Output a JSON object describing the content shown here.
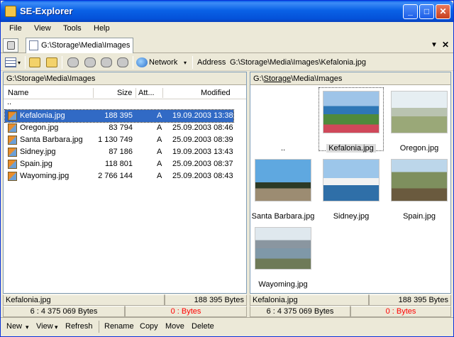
{
  "window": {
    "title": "SE-Explorer",
    "minimize": "_",
    "maximize": "□",
    "close": "✕"
  },
  "menu": [
    "File",
    "View",
    "Tools",
    "Help"
  ],
  "tab": {
    "label": "G:\\Storage\\Media\\Images",
    "dropdown": "▼",
    "close": "✕"
  },
  "toolbar": {
    "network_label": "Network",
    "address_label": "Address",
    "address_value": "G:\\Storage\\Media\\Images\\Kefalonia.jpg",
    "icons": [
      "view-mode-icon",
      "new-folder-icon",
      "up-folder-icon",
      "drive-c-icon",
      "drive-e-icon",
      "drive-f-icon",
      "drive-g-icon",
      "network-icon"
    ]
  },
  "left_pane": {
    "path": "G:\\Storage\\Media\\Images",
    "columns": [
      "Name",
      "Size",
      "Att...",
      "Modified"
    ],
    "parent": "..",
    "rows": [
      {
        "name": "Kefalonia.jpg",
        "size": "188 395",
        "attr": "A",
        "modified": "19.09.2003 13:38",
        "selected": true
      },
      {
        "name": "Oregon.jpg",
        "size": "83 794",
        "attr": "A",
        "modified": "25.09.2003 08:46"
      },
      {
        "name": "Santa Barbara.jpg",
        "size": "1 130 749",
        "attr": "A",
        "modified": "25.09.2003 08:39"
      },
      {
        "name": "Sidney.jpg",
        "size": "87 186",
        "attr": "A",
        "modified": "19.09.2003 13:43"
      },
      {
        "name": "Spain.jpg",
        "size": "118 801",
        "attr": "A",
        "modified": "25.09.2003 08:37"
      },
      {
        "name": "Wayoming.jpg",
        "size": "2 766 144",
        "attr": "A",
        "modified": "25.09.2003 08:43"
      }
    ],
    "status_name": "Kefalonia.jpg",
    "status_size": "188 395 Bytes",
    "total": "6 : 4 375 069 Bytes",
    "selected_total": "0 :  Bytes"
  },
  "right_pane": {
    "path_prefix": "G:\\",
    "path_link": "Storage",
    "path_suffix": "\\Media\\Images",
    "parent": "..",
    "thumbs": [
      {
        "name": "Kefalonia.jpg",
        "selected": true
      },
      {
        "name": "Oregon.jpg"
      },
      {
        "name": "Santa Barbara.jpg"
      },
      {
        "name": "Sidney.jpg"
      },
      {
        "name": "Spain.jpg"
      },
      {
        "name": "Wayoming.jpg"
      }
    ],
    "status_name": "Kefalonia.jpg",
    "status_size": "188 395 Bytes",
    "total": "6 : 4 375 069 Bytes",
    "selected_total": "0 :  Bytes"
  },
  "bottom_bar": {
    "new": "New",
    "view": "View",
    "refresh": "Refresh",
    "rename": "Rename",
    "copy": "Copy",
    "move": "Move",
    "delete": "Delete",
    "arrow": "▾"
  },
  "colors": {
    "title_blue": "#0a5fe8",
    "selection": "#316ac5",
    "status_red": "#ff0000"
  }
}
